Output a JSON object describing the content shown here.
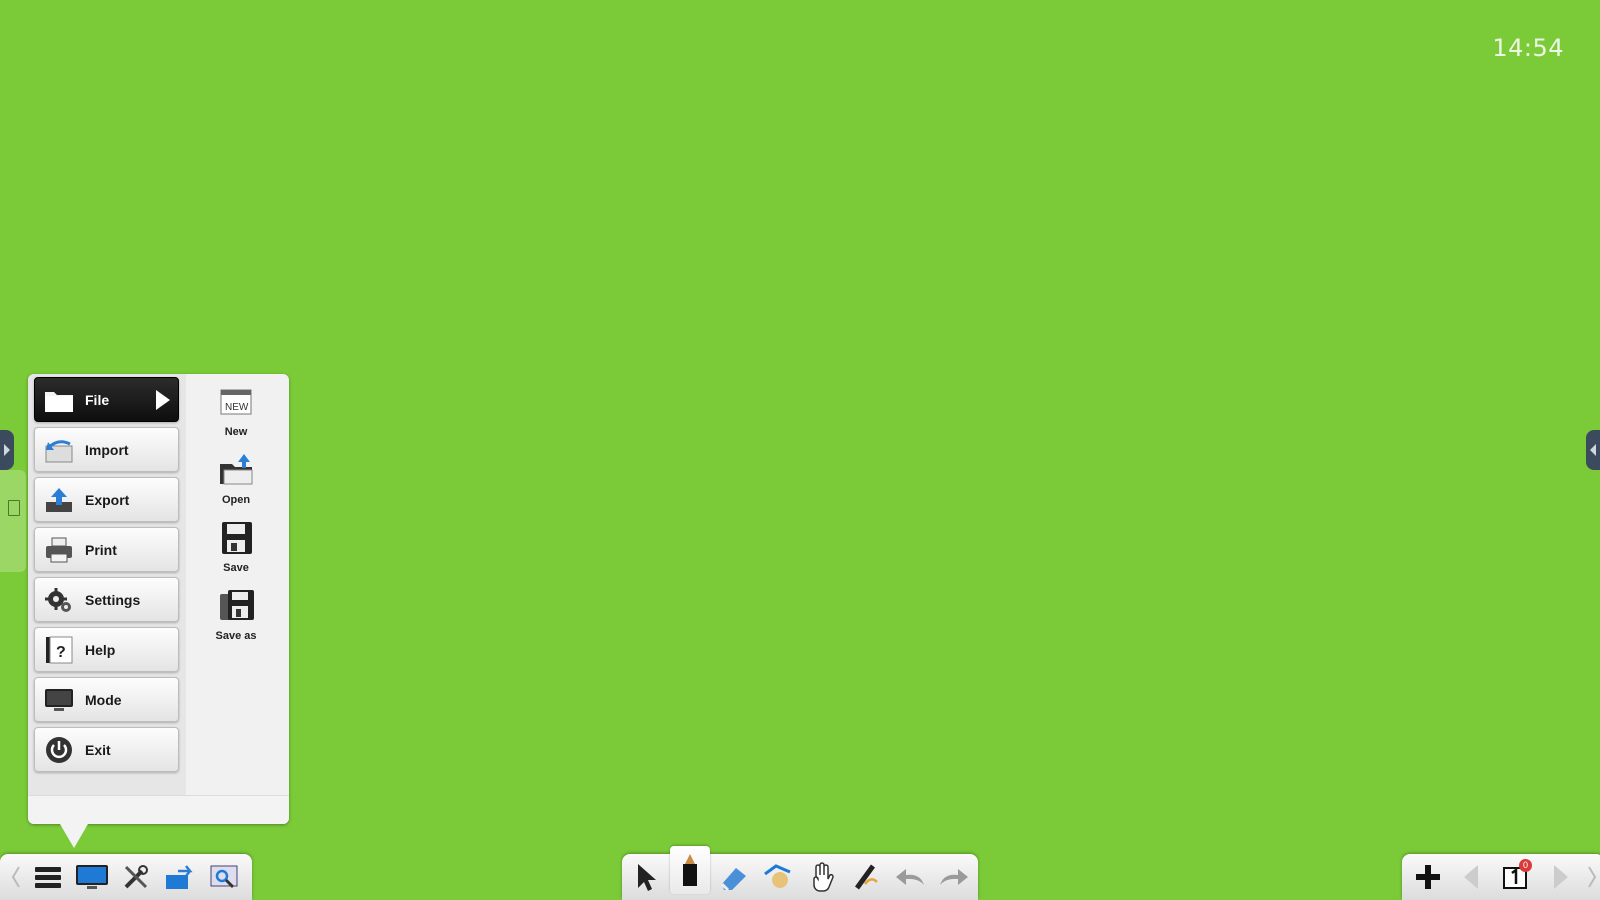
{
  "clock": {
    "time": "14:54"
  },
  "menu": {
    "items": [
      {
        "id": "file",
        "label": "File",
        "icon": "folder-icon",
        "active": true
      },
      {
        "id": "import",
        "label": "Import",
        "icon": "import-icon"
      },
      {
        "id": "export",
        "label": "Export",
        "icon": "export-icon"
      },
      {
        "id": "print",
        "label": "Print",
        "icon": "printer-icon"
      },
      {
        "id": "settings",
        "label": "Settings",
        "icon": "gear-icon"
      },
      {
        "id": "help",
        "label": "Help",
        "icon": "help-icon"
      },
      {
        "id": "mode",
        "label": "Mode",
        "icon": "monitor-icon"
      },
      {
        "id": "exit",
        "label": "Exit",
        "icon": "power-icon"
      }
    ],
    "sub_items": [
      {
        "id": "new",
        "label": "New",
        "icon": "new-file-icon",
        "icon_text": "NEW"
      },
      {
        "id": "open",
        "label": "Open",
        "icon": "open-folder-icon"
      },
      {
        "id": "save",
        "label": "Save",
        "icon": "floppy-disk-icon"
      },
      {
        "id": "save_as",
        "label": "Save as",
        "icon": "save-as-icon"
      }
    ]
  },
  "toolbar_left": [
    "menu-icon",
    "desktop-icon",
    "tools-icon",
    "transfer-icon",
    "screenshot-icon"
  ],
  "toolbar_center": [
    "pointer-icon",
    "pen-icon",
    "eraser-icon",
    "shape-icon",
    "hand-icon",
    "smart-pen-icon",
    "undo-icon",
    "redo-icon"
  ],
  "toolbar_right": {
    "icons": [
      "add-page-icon",
      "previous-page-icon",
      "page-count-icon",
      "next-page-icon"
    ],
    "page_badge": "0"
  },
  "colors": {
    "background": "#7bcb39",
    "panel": "#f1f1f1",
    "active_button": "#111111"
  }
}
